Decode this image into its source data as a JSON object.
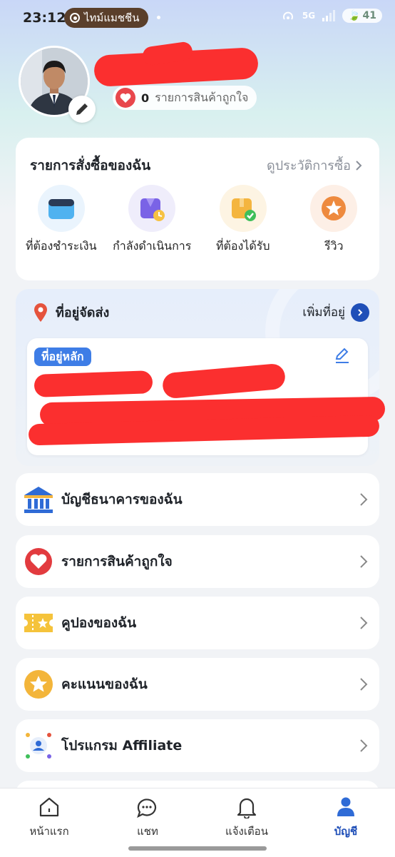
{
  "status_bar": {
    "time": "23:12",
    "chip_label": "ไทม์แมชชีน",
    "battery": "41",
    "network": "5G"
  },
  "profile": {
    "favorites_count": "0",
    "favorites_label": "รายการสินค้าถูกใจ"
  },
  "orders": {
    "title": "รายการสั่งซื้อของฉัน",
    "history_link": "ดูประวัติการซื้อ",
    "items": [
      {
        "label": "ที่ต้องชำระเงิน",
        "icon": "wallet-icon"
      },
      {
        "label": "กำลังดำเนินการ",
        "icon": "processing-box-icon"
      },
      {
        "label": "ที่ต้องได้รับ",
        "icon": "package-received-icon"
      },
      {
        "label": "รีวิว",
        "icon": "star-review-icon"
      }
    ]
  },
  "address": {
    "title": "ที่อยู่จัดส่ง",
    "add_label": "เพิ่มที่อยู่",
    "main_tag": "ที่อยู่หลัก"
  },
  "menu": [
    {
      "label": "บัญชีธนาคารของฉัน",
      "icon": "bank-icon"
    },
    {
      "label": "รายการสินค้าถูกใจ",
      "icon": "heart-icon"
    },
    {
      "label": "คูปองของฉัน",
      "icon": "coupon-icon"
    },
    {
      "label": "คะแนนของฉัน",
      "icon": "star-points-icon"
    },
    {
      "label": "โปรแกรม Affiliate",
      "icon": "affiliate-icon"
    }
  ],
  "nav": [
    {
      "label": "หน้าแรก",
      "icon": "home-icon"
    },
    {
      "label": "แชท",
      "icon": "chat-icon"
    },
    {
      "label": "แจ้งเตือน",
      "icon": "bell-icon"
    },
    {
      "label": "บัญชี",
      "icon": "account-icon"
    }
  ],
  "colors": {
    "accent": "#1f4fb8",
    "redaction": "#fb2f2f",
    "tag_blue": "#3e7de6"
  }
}
